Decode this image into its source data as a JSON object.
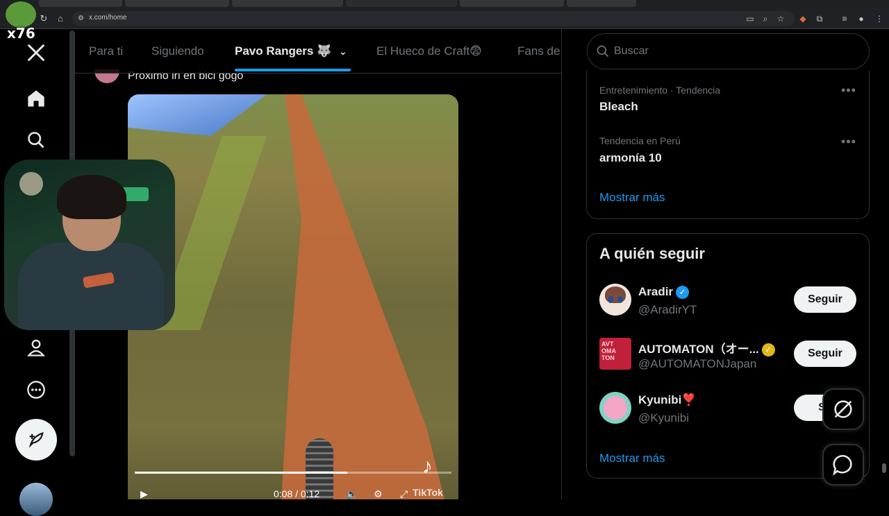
{
  "browser": {
    "url": "x.com/home"
  },
  "overlay": {
    "badge": "x76"
  },
  "tabs": [
    {
      "label": "Para ti",
      "active": false
    },
    {
      "label": "Siguiendo",
      "active": false
    },
    {
      "label": "Pavo Rangers 🐺",
      "active": true
    },
    {
      "label": "El Hueco de Craft😨",
      "active": false
    },
    {
      "label": "Fans de",
      "active": false
    }
  ],
  "post": {
    "text": "Proximo iri en bici gogo",
    "video": {
      "time": "0:08 / 0:12",
      "watermark": "TikTok",
      "progress": 0.67
    }
  },
  "search": {
    "placeholder": "Buscar"
  },
  "trends": [
    {
      "category": "Entretenimiento · Tendencia",
      "name": "Bleach"
    },
    {
      "category": "Tendencia en Perú",
      "name": "armonía 10"
    }
  ],
  "trends_more": "Mostrar más",
  "who_to_follow": {
    "title": "A quién seguir",
    "accounts": [
      {
        "name": "Aradir",
        "handle": "@AradirYT",
        "badge": "verified-blue",
        "button": "Seguir"
      },
      {
        "name": "AUTOMATON（オー...",
        "handle": "@AUTOMATONJapan",
        "badge": "verified-gold",
        "button": "Seguir"
      },
      {
        "name": "Kyunibi❣️",
        "handle": "@Kyunibi",
        "badge": "",
        "button": "Se"
      }
    ],
    "more": "Mostrar más"
  },
  "colors": {
    "accent": "#1d9bf0",
    "background": "#000000",
    "border": "#2f3336",
    "text_primary": "#e7e9ea",
    "text_secondary": "#71767b",
    "gold": "#e2b719"
  }
}
